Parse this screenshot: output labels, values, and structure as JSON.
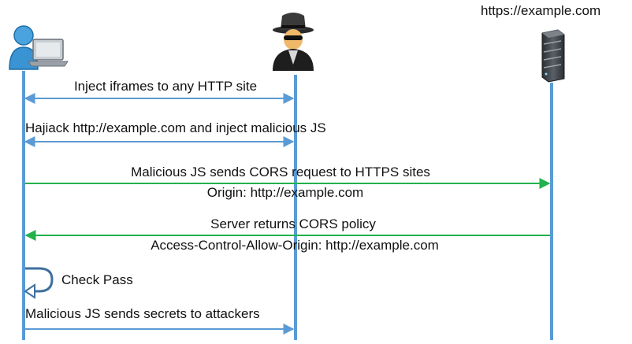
{
  "header": {
    "server_url": "https://example.com"
  },
  "actors": {
    "user": {
      "icon": "user-laptop-icon"
    },
    "attacker": {
      "icon": "hacker-icon"
    },
    "server": {
      "icon": "server-icon"
    }
  },
  "colors": {
    "lifeline": "#5b9bd5",
    "attacker_arrow": "#5b9bd5",
    "cors_arrow": "#22b14c"
  },
  "messages": {
    "m1": "Inject iframes to any HTTP site",
    "m2": "Hajiack http://example.com and inject  malicious JS",
    "m3_line1": "Malicious JS sends CORS request to HTTPS sites",
    "m3_line2": "Origin: http://example.com",
    "m4_line1": "Server returns CORS policy",
    "m4_line2": "Access-Control-Allow-Origin: http://example.com",
    "m5": "Check Pass",
    "m6": "Malicious JS sends secrets to attackers"
  }
}
